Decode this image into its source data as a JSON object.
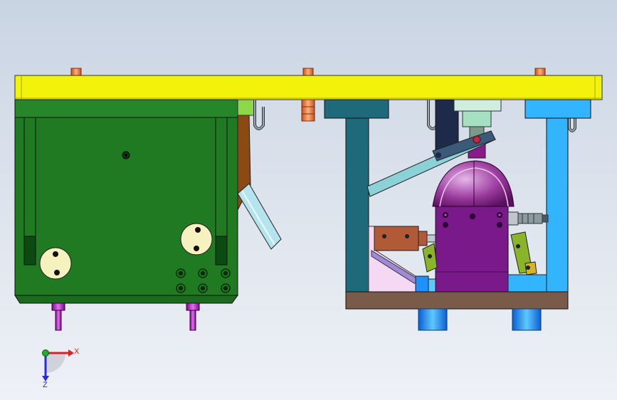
{
  "viewport": {
    "background_top": "#c9d4e3",
    "background_bottom": "#eef1f6"
  },
  "triad": {
    "x_label": "X",
    "z_label": "Z",
    "x_color": "#e0201a",
    "y_color": "#1fae2a",
    "z_color": "#2a2ad8"
  },
  "colors": {
    "top_plate": "#f2f20a",
    "green_body": "#1f7a22",
    "left_frame": "#1f6a7a",
    "right_frame": "#33b4ff",
    "base_plate": "#7a5a48",
    "purple_body": "#7a1a8a",
    "bolts": "#e87a3a",
    "feet_blue": "#1e90ff",
    "handle": "#9fd8e6",
    "violet_pins": "#b020c0"
  }
}
